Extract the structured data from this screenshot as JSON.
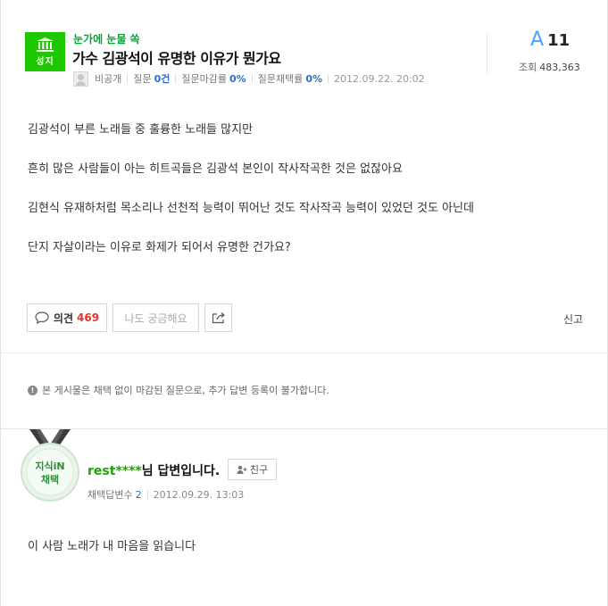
{
  "question": {
    "badge_text": "성지",
    "category": "눈가에 눈물 쏙",
    "title": "가수 김광석이 유명한 이유가 뭔가요",
    "author": "비공개",
    "meta": {
      "questions_label": "질문",
      "questions_value": "0건",
      "close_rate_label": "질문마감률",
      "close_rate_value": "0%",
      "adopt_rate_label": "질문채택률",
      "adopt_rate_value": "0%",
      "date": "2012.09.22. 20:02"
    },
    "answers_letter": "A",
    "answers_count": "11",
    "views_label": "조회",
    "views_value": "483,363",
    "body": [
      "김광석이 부른 노래들 중 훌륭한 노래들 많지만",
      "흔히 많은 사람들이 아는 히트곡들은 김광석 본인이 작사작곡한 것은 없잖아요",
      "김현식 유재하처럼 목소리나 선천적 능력이 뛰어난 것도 작사작곡 능력이 있었던 것도 아닌데",
      "단지 자살이라는 이유로 화제가 되어서 유명한 건가요?"
    ],
    "actions": {
      "opinion_label": "의견",
      "opinion_count": "469",
      "curious_label": "나도 궁금해요",
      "report_label": "신고"
    },
    "closed_notice": "본 게시물은 채택 없이 마감된 질문으로, 추가 답변 등록이 불가합니다."
  },
  "answer": {
    "medal_line1": "지식iN",
    "medal_line2": "채택",
    "answerer_id": "rest",
    "answerer_stars": "****",
    "answerer_suffix": "님 답변입니다.",
    "friend_label": "친구",
    "adopted_label": "채택답변수",
    "adopted_value": "2",
    "date": "2012.09.29. 13:03",
    "text": "이 사람 노래가 내 마음을 읽습니다"
  },
  "colors": {
    "brand_green": "#1ec800",
    "link_blue": "#2b6ec7",
    "answer_blue": "#4aa3ff",
    "count_red": "#e3342f"
  },
  "icons": {
    "badge": "building-icon",
    "share": "share-icon",
    "opinion": "speech-bubble-icon",
    "info": "info-icon",
    "friend": "add-friend-icon"
  }
}
